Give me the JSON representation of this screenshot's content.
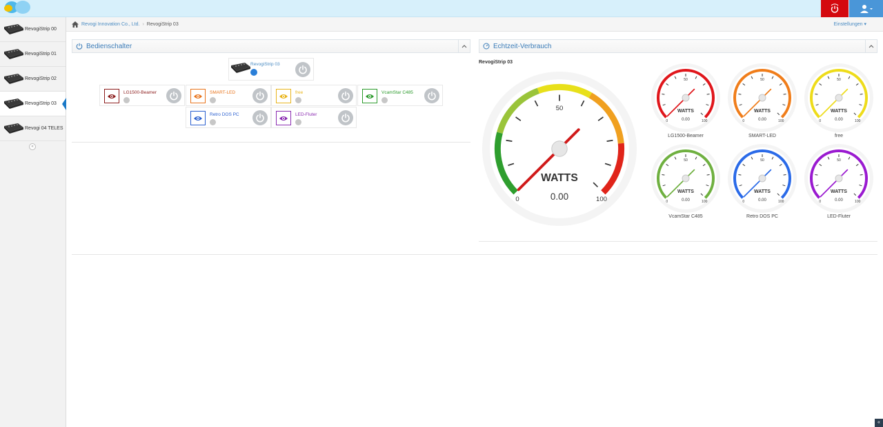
{
  "sidebar": {
    "items": [
      {
        "label": "RevogiStrip 00"
      },
      {
        "label": "RevogiStrip 01"
      },
      {
        "label": "RevogiStrip 02"
      },
      {
        "label": "RevogiStrip 03"
      },
      {
        "label": "Revogi 04 TELES"
      }
    ],
    "active_index": 3
  },
  "breadcrumb": {
    "home": "Revogi Innovation Co., Ltd.",
    "current": "RevogiStrip 03",
    "settings": "Einstellungen"
  },
  "switch_panel": {
    "title": "Bedienschalter",
    "main": {
      "name": "RevogiStrip 03"
    },
    "sockets": [
      {
        "name": "LG1500-Beamer",
        "color": "#8b1a1a"
      },
      {
        "name": "SMART-LED",
        "color": "#e8731a"
      },
      {
        "name": "free",
        "color": "#e8b41a"
      },
      {
        "name": "VcamStar C485",
        "color": "#2a9a2a"
      },
      {
        "name": "Retro DOS PC",
        "color": "#2a5fcf"
      },
      {
        "name": "LED-Fluter",
        "color": "#8a2ab0"
      }
    ]
  },
  "consumption_panel": {
    "title": "Echtzeit-Verbrauch",
    "strip_name": "RevogiStrip 03",
    "main_gauge": {
      "unit": "WATTS",
      "value": "0.00",
      "min": "0",
      "mid": "50",
      "max": "100",
      "level": 0
    },
    "gauges": [
      {
        "label": "LG1500-Beamer",
        "unit": "WATTS",
        "value": "0.00",
        "color": "#e0161b",
        "level": 0,
        "mid": "50",
        "min": "0",
        "max": "100"
      },
      {
        "label": "SMART-LED",
        "unit": "WATTS",
        "value": "0.00",
        "color": "#f07d1a",
        "level": 0,
        "mid": "50",
        "min": "0",
        "max": "100"
      },
      {
        "label": "free",
        "unit": "WATTS",
        "value": "0.00",
        "color": "#eedc1a",
        "level": 0,
        "mid": "50",
        "min": "0",
        "max": "100"
      },
      {
        "label": "VcamStar C485",
        "unit": "WATTS",
        "value": "0.00",
        "color": "#6fb040",
        "level": 0,
        "mid": "50",
        "min": "0",
        "max": "100"
      },
      {
        "label": "Retro DOS PC",
        "unit": "WATTS",
        "value": "0.00",
        "color": "#2a6ae8",
        "level": 0,
        "mid": "50",
        "min": "0",
        "max": "100"
      },
      {
        "label": "LED-Fluter",
        "unit": "WATTS",
        "value": "0.00",
        "color": "#9a1ad0",
        "level": 0,
        "mid": "50",
        "min": "0",
        "max": "100"
      }
    ]
  },
  "colors": {
    "accent": "#3b7cb8",
    "power_button": "#d4090f",
    "user_button": "#4a96d8"
  }
}
